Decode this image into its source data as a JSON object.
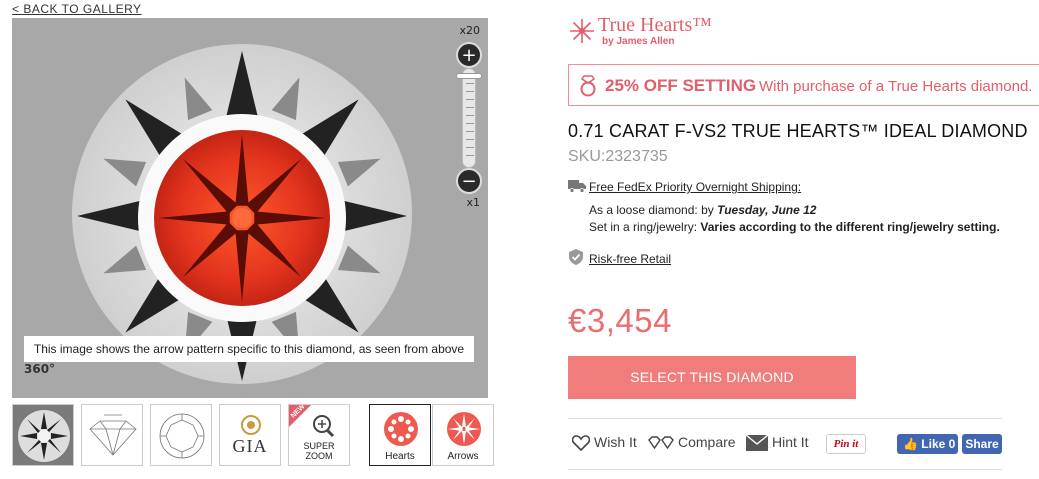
{
  "nav": {
    "back_label": "< BACK TO GALLERY"
  },
  "viewer": {
    "zoom_max_label": "x20",
    "zoom_min_label": "x1",
    "zoom_in_symbol": "+",
    "zoom_out_symbol": "−",
    "caption": "This image shows the arrow pattern specific to this diamond, as seen from above",
    "badge_360": "360°"
  },
  "thumbnails": [
    {
      "label": "",
      "icon": "diamond-photo-icon"
    },
    {
      "label": "",
      "icon": "diamond-profile-diagram-icon"
    },
    {
      "label": "",
      "icon": "diamond-top-diagram-icon"
    },
    {
      "label": "GIA",
      "icon": "gia-logo-icon"
    },
    {
      "label": "SUPER ZOOM",
      "badge": "NEW",
      "icon": "magnifier-icon"
    },
    {
      "label": "Hearts",
      "icon": "hearts-pattern-icon",
      "active": true
    },
    {
      "label": "Arrows",
      "icon": "arrows-pattern-icon"
    }
  ],
  "brand": {
    "name": "True Hearts™",
    "sub": "by James Allen",
    "color": "#e35d6a"
  },
  "promo": {
    "strong": "25% OFF SETTING",
    "rest": "With purchase of a True Hearts diamond."
  },
  "product": {
    "title": "0.71 CARAT F-VS2 TRUE HEARTS™ IDEAL DIAMOND",
    "sku": "SKU:2323735"
  },
  "shipping": {
    "link": "Free FedEx Priority Overnight Shipping:",
    "loose_prefix": "As a loose diamond: by ",
    "loose_date": "Tuesday, June 12",
    "ring_prefix": "Set in a ring/jewelry: ",
    "ring_value": "Varies according to the different ring/jewelry setting."
  },
  "risk": {
    "link": "Risk-free Retail"
  },
  "price": {
    "value": "€3,454",
    "color": "#ea6d70"
  },
  "cta": {
    "label": "SELECT THIS DIAMOND",
    "color": "#f07c7b"
  },
  "actions": {
    "wish": "Wish It",
    "compare": "Compare",
    "hint": "Hint It",
    "pin": "Pin it",
    "like": "Like 0",
    "share": "Share"
  }
}
